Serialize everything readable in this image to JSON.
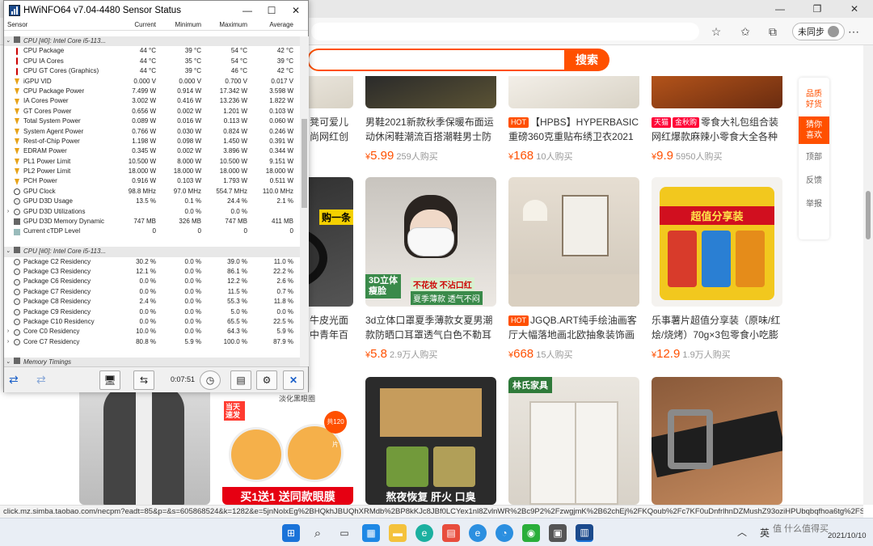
{
  "browser": {
    "sync_label": "未同步",
    "search_button": "搜索",
    "status_url": "click.mz.simba.taobao.com/necpm?eadt=85&p=&s=605868524&k=1282&e=5jnNolxEg%2BHQkhJBUQhXRMdb%2BP8kKJc8JBf0LCYex1nl8ZvlnWR%2Bc9P2%2FzwgjmK%2B62chEj%2FKQoub%2Fc7KF0uDnfrlhnDZMushZ93oziHPUbqbqfhoa6tg%2FSV2sgZGcvgt%2F..."
  },
  "floatbar": {
    "item1": "品质好货",
    "item2": "猜你喜欢",
    "item3": "顶部",
    "item4": "反馈",
    "item5": "举报"
  },
  "cards_row1": [
    {
      "title_a": "凳可爱儿",
      "title_b": "尚网红创"
    },
    {
      "title": "男鞋2021新款秋季保暖布面运动休闲鞋潮流百搭潮鞋男士防",
      "price": "5.99",
      "sold": "259人购买"
    },
    {
      "tag": "HOT",
      "title": "【HPBS】HYPERBASIC重磅360克重贴布绣卫衣2021秋",
      "price": "168",
      "sold": "10人购买"
    },
    {
      "tag1": "天猫",
      "tag2": "金秋购",
      "title": "零食大礼包组合装网红爆款麻辣小零食大全各种",
      "price": "9.9",
      "sold": "5950人购买"
    }
  ],
  "cards_row2": [
    {
      "banner": "购一条",
      "title_a": "牛皮光面",
      "title_b": "中青年百"
    },
    {
      "overlay1": "3D立体",
      "overlay2": "瘦脸",
      "overlay3": "不花妆 不沾口红",
      "overlay4": "夏季薄款 透气不闷",
      "title": "3d立体口罩夏季薄款女夏男潮款防晒口耳罩透气白色不勒耳",
      "price": "5.8",
      "sold": "2.9万人购买"
    },
    {
      "tag": "HOT",
      "title": "JGQB.ART纯手绘油画客厅大幅落地画北欧抽象装饰画",
      "price": "668",
      "sold": "15人购买"
    },
    {
      "overlay1": "超值分享装",
      "title": "乐事薯片超值分享装（原味/红烩/烧烤）70g×3包零食小吃膨",
      "price": "12.9",
      "sold": "1.9万人购买"
    }
  ],
  "cards_row3": [
    {
      "overlay1": "当天速发",
      "overlay2": "淡化黑眼圈",
      "overlay3": "共120片",
      "overlay4": "买1送1 送同款眼膜"
    },
    {
      "overlay1": "熬夜恢复  肝火  口臭"
    },
    {
      "overlay1": "林氏家具"
    },
    {}
  ],
  "hwinfo": {
    "title": "HWiNFO64 v7.04-4480 Sensor Status",
    "columns": [
      "Sensor",
      "Current",
      "Minimum",
      "Maximum",
      "Average"
    ],
    "rows": [
      {
        "type": "group",
        "name": "CPU [#0]: Intel Core i5-113..."
      },
      {
        "icon": "therm",
        "name": "CPU Package",
        "cur": "44 °C",
        "min": "39 °C",
        "max": "54 °C",
        "avg": "42 °C"
      },
      {
        "icon": "therm",
        "name": "CPU IA Cores",
        "cur": "44 °C",
        "min": "35 °C",
        "max": "54 °C",
        "avg": "39 °C"
      },
      {
        "icon": "therm",
        "name": "CPU GT Cores (Graphics)",
        "cur": "44 °C",
        "min": "39 °C",
        "max": "46 °C",
        "avg": "42 °C"
      },
      {
        "icon": "bolt",
        "name": "iGPU VID",
        "cur": "0.000 V",
        "min": "0.000 V",
        "max": "0.700 V",
        "avg": "0.017 V"
      },
      {
        "icon": "bolt",
        "name": "CPU Package Power",
        "cur": "7.499 W",
        "min": "0.914 W",
        "max": "17.342 W",
        "avg": "3.598 W"
      },
      {
        "icon": "bolt",
        "name": "IA Cores Power",
        "cur": "3.002 W",
        "min": "0.416 W",
        "max": "13.236 W",
        "avg": "1.822 W"
      },
      {
        "icon": "bolt",
        "name": "GT Cores Power",
        "cur": "0.656 W",
        "min": "0.002 W",
        "max": "1.201 W",
        "avg": "0.103 W"
      },
      {
        "icon": "bolt",
        "name": "Total System Power",
        "cur": "0.089 W",
        "min": "0.016 W",
        "max": "0.113 W",
        "avg": "0.060 W"
      },
      {
        "icon": "bolt",
        "name": "System Agent Power",
        "cur": "0.766 W",
        "min": "0.030 W",
        "max": "0.824 W",
        "avg": "0.246 W"
      },
      {
        "icon": "bolt",
        "name": "Rest-of-Chip Power",
        "cur": "1.198 W",
        "min": "0.098 W",
        "max": "1.450 W",
        "avg": "0.391 W"
      },
      {
        "icon": "bolt",
        "name": "EDRAM Power",
        "cur": "0.345 W",
        "min": "0.002 W",
        "max": "3.896 W",
        "avg": "0.344 W"
      },
      {
        "icon": "bolt",
        "name": "PL1 Power Limit",
        "cur": "10.500 W",
        "min": "8.000 W",
        "max": "10.500 W",
        "avg": "9.151 W"
      },
      {
        "icon": "bolt",
        "name": "PL2 Power Limit",
        "cur": "18.000 W",
        "min": "18.000 W",
        "max": "18.000 W",
        "avg": "18.000 W"
      },
      {
        "icon": "bolt",
        "name": "PCH Power",
        "cur": "0.916 W",
        "min": "0.103 W",
        "max": "1.793 W",
        "avg": "0.511 W"
      },
      {
        "icon": "clock",
        "name": "GPU Clock",
        "cur": "98.8 MHz",
        "min": "97.0 MHz",
        "max": "554.7 MHz",
        "avg": "110.0 MHz"
      },
      {
        "icon": "circle",
        "name": "GPU D3D Usage",
        "cur": "13.5 %",
        "min": "0.1 %",
        "max": "24.4 %",
        "avg": "2.1 %"
      },
      {
        "icon": "circle",
        "expand": ">",
        "name": "GPU D3D Utilizations",
        "cur": "",
        "min": "0.0 %",
        "max": "0.0 %",
        "avg": ""
      },
      {
        "icon": "chip",
        "name": "GPU D3D Memory Dynamic",
        "cur": "747 MB",
        "min": "326 MB",
        "max": "747 MB",
        "avg": "411 MB"
      },
      {
        "icon": "sq",
        "name": "Current cTDP Level",
        "cur": "0",
        "min": "0",
        "max": "0",
        "avg": "0"
      },
      {
        "type": "blank"
      },
      {
        "type": "group",
        "name": "CPU [#0]: Intel Core i5-113..."
      },
      {
        "icon": "circle",
        "name": "Package C2 Residency",
        "cur": "30.2 %",
        "min": "0.0 %",
        "max": "39.0 %",
        "avg": "11.0 %"
      },
      {
        "icon": "circle",
        "name": "Package C3 Residency",
        "cur": "12.1 %",
        "min": "0.0 %",
        "max": "86.1 %",
        "avg": "22.2 %"
      },
      {
        "icon": "circle",
        "name": "Package C6 Residency",
        "cur": "0.0 %",
        "min": "0.0 %",
        "max": "12.2 %",
        "avg": "2.6 %"
      },
      {
        "icon": "circle",
        "name": "Package C7 Residency",
        "cur": "0.0 %",
        "min": "0.0 %",
        "max": "11.5 %",
        "avg": "0.7 %"
      },
      {
        "icon": "circle",
        "name": "Package C8 Residency",
        "cur": "2.4 %",
        "min": "0.0 %",
        "max": "55.3 %",
        "avg": "11.8 %"
      },
      {
        "icon": "circle",
        "name": "Package C9 Residency",
        "cur": "0.0 %",
        "min": "0.0 %",
        "max": "5.0 %",
        "avg": "0.0 %"
      },
      {
        "icon": "circle",
        "name": "Package C10 Residency",
        "cur": "0.0 %",
        "min": "0.0 %",
        "max": "65.5 %",
        "avg": "22.5 %"
      },
      {
        "icon": "circle",
        "expand": ">",
        "name": "Core C0 Residency",
        "cur": "10.0 %",
        "min": "0.0 %",
        "max": "64.3 %",
        "avg": "5.9 %"
      },
      {
        "icon": "circle",
        "expand": ">",
        "name": "Core C7 Residency",
        "cur": "80.8 %",
        "min": "5.9 %",
        "max": "100.0 %",
        "avg": "87.9 %"
      },
      {
        "type": "blank"
      },
      {
        "type": "group",
        "name": "Memory Timings"
      }
    ],
    "elapsed": "0:07:51"
  },
  "taskbar": {
    "lang": "英",
    "date": "2021/10/10",
    "watermark": "值 什么值得买"
  }
}
